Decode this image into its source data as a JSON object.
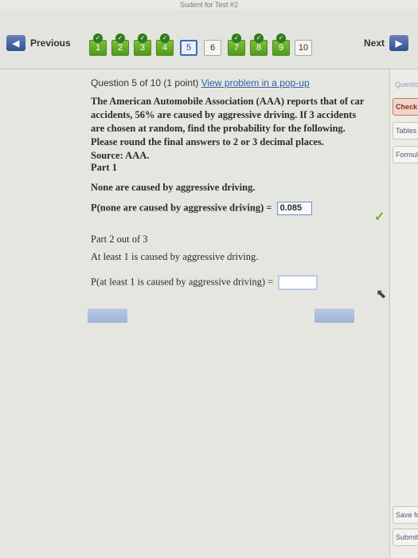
{
  "top_title": "Sudent for Test #2",
  "nav": {
    "previous_label": "Previous",
    "next_label": "Next",
    "questions": [
      {
        "label": "1",
        "state": "done"
      },
      {
        "label": "2",
        "state": "done"
      },
      {
        "label": "3",
        "state": "done"
      },
      {
        "label": "4",
        "state": "done"
      },
      {
        "label": "5",
        "state": "current"
      },
      {
        "label": "6",
        "state": "normal"
      },
      {
        "label": "7",
        "state": "done"
      },
      {
        "label": "8",
        "state": "done"
      },
      {
        "label": "9",
        "state": "done"
      },
      {
        "label": "10",
        "state": "normal"
      }
    ]
  },
  "question": {
    "header": "Question 5 of 10 (1 point)",
    "popup_link": "View problem in a pop-up",
    "stem_line1": "The American Automobile Association (AAA) reports that of car accidents, 56% are caused by aggressive driving. If 3 accidents are chosen at random, find the probability for the following.",
    "stem_line2": "Please round the final answers to 2 or 3 decimal places.",
    "source": "Source: AAA.",
    "part1_label": "Part 1",
    "part1_prompt": "None are caused by aggressive driving.",
    "part1_expr": "P(none are caused by aggressive driving) =",
    "part1_answer": "0.085",
    "part2_label": "Part 2 out of 3",
    "part2_prompt": "At least 1 is caused by aggressive driving.",
    "part2_expr": "P(at least 1 is caused by aggressive driving) =",
    "part2_answer": ""
  },
  "sidebar": {
    "question_label": "Questio",
    "check_answer": "Check An",
    "tables": "Tables",
    "formula": "Formula",
    "save_for_later": "Save for La",
    "submit": "Submit Assig"
  }
}
